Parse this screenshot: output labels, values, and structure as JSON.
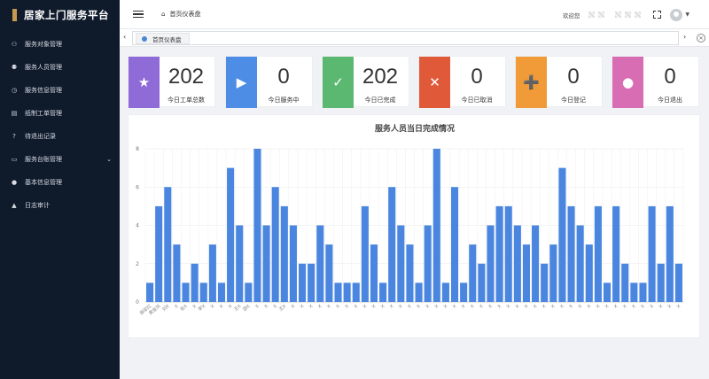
{
  "sidebar": {
    "title": "居家上门服务平台",
    "items": [
      {
        "label": "服务对象管理",
        "icon": "users-icon",
        "glyph": "⚇"
      },
      {
        "label": "服务人员管理",
        "icon": "user-manage-icon",
        "glyph": "⚉"
      },
      {
        "label": "服务信息管理",
        "icon": "clock-icon",
        "glyph": "◷"
      },
      {
        "label": "纸制工单管理",
        "icon": "file-icon",
        "glyph": "▤"
      },
      {
        "label": "待退出记录",
        "icon": "question-icon",
        "glyph": "?"
      },
      {
        "label": "服务台账管理",
        "icon": "ledger-icon",
        "glyph": "▭",
        "expandable": true
      },
      {
        "label": "基本信息管理",
        "icon": "info-icon",
        "glyph": "●"
      },
      {
        "label": "日志审计",
        "icon": "warning-icon",
        "glyph": "▲"
      }
    ]
  },
  "header": {
    "breadcrumb": "首页仪表盘",
    "welcome": "欢迎您"
  },
  "tabs": [
    {
      "label": "首页仪表盘",
      "active": true
    }
  ],
  "stats": [
    {
      "value": "202",
      "label": "今日工单总数",
      "color": "#8e6bd6",
      "icon": "star-icon",
      "glyph": "★"
    },
    {
      "value": "0",
      "label": "今日服务中",
      "color": "#4d8de6",
      "icon": "play-icon",
      "glyph": "▶"
    },
    {
      "value": "202",
      "label": "今日已完成",
      "color": "#5bb871",
      "icon": "check-icon",
      "glyph": "✓"
    },
    {
      "value": "0",
      "label": "今日已取消",
      "color": "#e05a3a",
      "icon": "close-icon",
      "glyph": "✕"
    },
    {
      "value": "0",
      "label": "今日登记",
      "color": "#f09b38",
      "icon": "add-user-icon",
      "glyph": "➕"
    },
    {
      "value": "0",
      "label": "今日退出",
      "color": "#d86db4",
      "icon": "user-icon",
      "glyph": "●"
    }
  ],
  "chart_data": {
    "type": "bar",
    "title": "服务人员当日完成情况",
    "ylim": [
      0,
      8
    ],
    "yticks": [
      0,
      2,
      4,
      6,
      8
    ],
    "grid": true,
    "bar_color": "#4a86e0",
    "categories": [
      "薛翠红",
      "黄金凤",
      "刘X",
      "X",
      "张X",
      "X",
      "李X",
      "X",
      "X",
      "X",
      "王X",
      "邵X",
      "X",
      "X",
      "X",
      "王X",
      "X",
      "X",
      "X",
      "X",
      "X",
      "X",
      "X",
      "X",
      "X",
      "X",
      "X",
      "X",
      "X",
      "X",
      "X",
      "X",
      "X",
      "X",
      "X",
      "X",
      "X",
      "X",
      "X",
      "X",
      "X",
      "X",
      "X",
      "X",
      "X",
      "X",
      "X",
      "X",
      "X",
      "X",
      "X",
      "X",
      "X",
      "X",
      "X",
      "X",
      "X",
      "X",
      "X",
      "X",
      "X",
      "X"
    ],
    "values": [
      1,
      5,
      6,
      3,
      1,
      2,
      1,
      3,
      1,
      7,
      4,
      1,
      8,
      4,
      6,
      5,
      4,
      2,
      2,
      4,
      3,
      1,
      1,
      1,
      5,
      3,
      1,
      6,
      4,
      3,
      1,
      4,
      8,
      1,
      6,
      1,
      3,
      2,
      4,
      5,
      5,
      4,
      3,
      4,
      2,
      3,
      7,
      5,
      4,
      3,
      5,
      1,
      5,
      2,
      1,
      1,
      5,
      2,
      5,
      2
    ]
  }
}
